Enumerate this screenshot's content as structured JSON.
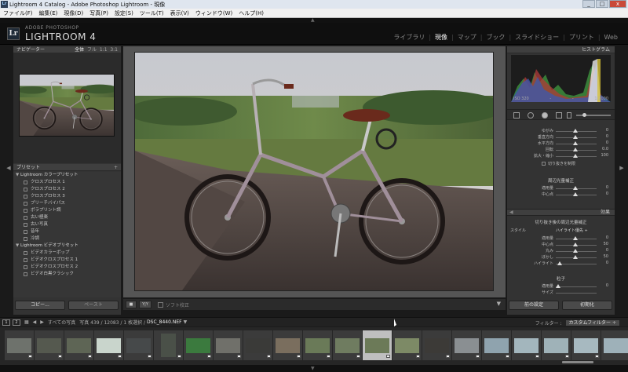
{
  "titlebar": {
    "icon": "Lr",
    "title": "Lightroom 4 Catalog - Adobe Photoshop Lightroom - 現像",
    "minimize": "_",
    "maximize": "□",
    "close": "x"
  },
  "menubar": [
    "ファイル(F)",
    "編集(E)",
    "現像(D)",
    "写真(P)",
    "設定(S)",
    "ツール(T)",
    "表示(V)",
    "ウィンドウ(W)",
    "ヘルプ(H)"
  ],
  "identity": {
    "logo": "Lr",
    "brand_small": "ADOBE PHOTOSHOP",
    "brand_large": "LIGHTROOM 4"
  },
  "modules": [
    "ライブラリ",
    "現像",
    "マップ",
    "ブック",
    "スライドショー",
    "プリント",
    "Web"
  ],
  "active_module": "現像",
  "left_panel": {
    "navigator": {
      "title": "ナビゲーター",
      "zoom_options": [
        "全体",
        "フル",
        "1:1",
        "3:1"
      ]
    },
    "presets": {
      "title": "プリセット",
      "add": "+",
      "folders": [
        {
          "name": "Lightroom カラープリセット",
          "items": [
            "クロスプロセス 1",
            "クロスプロセス 2",
            "クロスプロセス 3",
            "ブリーチバイパス",
            "ポラプリント調",
            "古い極楽",
            "古い写真",
            "昔年",
            "冷調"
          ]
        },
        {
          "name": "Lightroom ビデオプリセット",
          "items": [
            "ビデオカラーポップ",
            "ビデオクロスプロセス 1",
            "ビデオクロスプロセス 2",
            "ビデオ白黒クラシック"
          ]
        }
      ]
    },
    "copy_button": "コピー...",
    "paste_button": "ペースト"
  },
  "toolbar": {
    "view_btn": "■",
    "before_after_btn": "Y|Y",
    "soft_proof_label": "ソフト校正",
    "menu": "▼"
  },
  "right_panel": {
    "histogram": {
      "title": "ヒストグラム",
      "iso": "ISO 320",
      "dash1": "-",
      "dash2": "-",
      "shutter": "1/2000"
    },
    "lens_sliders": [
      {
        "label": "ゆがみ",
        "value": "0"
      },
      {
        "label": "垂直方向",
        "value": "0"
      },
      {
        "label": "水平方向",
        "value": "0"
      },
      {
        "label": "回転",
        "value": "0.0"
      },
      {
        "label": "拡大・縮小",
        "value": "100"
      }
    ],
    "crop_checkbox": "切り抜きを制限",
    "vignette_title": "周辺光量補正",
    "vignette_sliders": [
      {
        "label": "適用量",
        "value": "0"
      },
      {
        "label": "中心点",
        "value": "0"
      }
    ],
    "effects_title": "効果",
    "post_crop_title": "切り抜き後の周辺光量補正",
    "style_label": "スタイル",
    "style_value": "ハイライト優先 ÷",
    "post_crop_sliders": [
      {
        "label": "適用量",
        "value": "0"
      },
      {
        "label": "中心点",
        "value": "50"
      },
      {
        "label": "丸み",
        "value": "0"
      },
      {
        "label": "ぼかし",
        "value": "50"
      },
      {
        "label": "ハイライト",
        "value": "0"
      }
    ],
    "grain_title": "粒子",
    "grain_sliders": [
      {
        "label": "適用量",
        "value": "0"
      },
      {
        "label": "サイズ",
        "value": ""
      }
    ],
    "previous_button": "前の設定",
    "reset_button": "初期化"
  },
  "film_bar": {
    "monitor1": "1",
    "monitor2": "2",
    "all_photos": "すべての写真",
    "counts": "写真 439 / 12083 / 1 枚選択 /",
    "filename": "DSC_8440.NEF",
    "filename_arrow": "▼",
    "filter_label": "フィルター :",
    "filter_value": "カスタムフィルター ÷"
  },
  "colors": {
    "panel": "#333333",
    "background": "#1a1a1a",
    "selected_thumb": "#bfbfbf",
    "bike_frame": "#a08f9a",
    "saddle": "#6a2a1c"
  }
}
